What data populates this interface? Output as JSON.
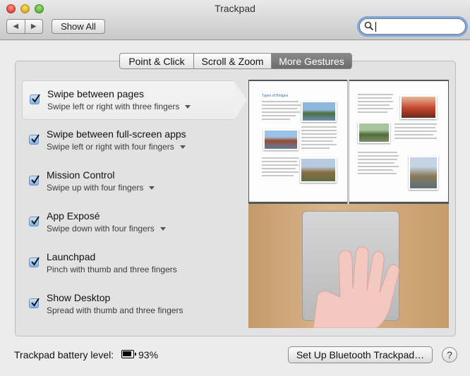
{
  "window": {
    "title": "Trackpad"
  },
  "toolbar": {
    "show_all_label": "Show All",
    "back_icon": "◀",
    "forward_icon": "▶"
  },
  "search": {
    "value": "",
    "placeholder": ""
  },
  "tabs": [
    {
      "label": "Point & Click",
      "active": false
    },
    {
      "label": "Scroll & Zoom",
      "active": false
    },
    {
      "label": "More Gestures",
      "active": true
    }
  ],
  "gestures": [
    {
      "title": "Swipe between pages",
      "desc": "Swipe left or right with three fingers",
      "checked": true,
      "has_menu": true,
      "selected": true
    },
    {
      "title": "Swipe between full-screen apps",
      "desc": "Swipe left or right with four fingers",
      "checked": true,
      "has_menu": true,
      "selected": false
    },
    {
      "title": "Mission Control",
      "desc": "Swipe up with four fingers",
      "checked": true,
      "has_menu": true,
      "selected": false
    },
    {
      "title": "App Exposé",
      "desc": "Swipe down with four fingers",
      "checked": true,
      "has_menu": true,
      "selected": false
    },
    {
      "title": "Launchpad",
      "desc": "Pinch with thumb and three fingers",
      "checked": true,
      "has_menu": false,
      "selected": false
    },
    {
      "title": "Show Desktop",
      "desc": "Spread with thumb and three fingers",
      "checked": true,
      "has_menu": false,
      "selected": false
    }
  ],
  "preview": {
    "book_heading": "Types of Bridges"
  },
  "footer": {
    "battery_label": "Trackpad battery level:",
    "battery_percent": "93%",
    "setup_button": "Set Up Bluetooth Trackpad…",
    "help_label": "?"
  },
  "colors": {
    "accent": "#7eb1ec",
    "active_tab": "#7a7a7a"
  }
}
